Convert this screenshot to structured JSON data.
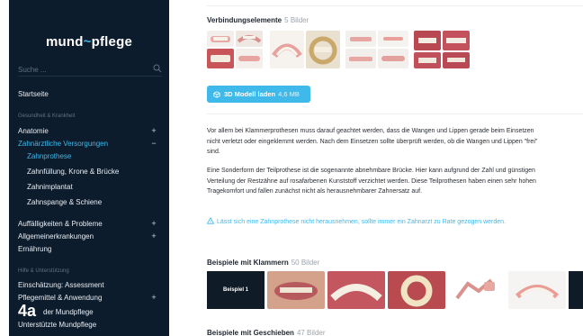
{
  "sidebar": {
    "logo_left": "mund",
    "logo_mid": "~",
    "logo_right": "pflege",
    "search_placeholder": "Suche ...",
    "home": "Startseite",
    "group1": "Gesundheit & Krankheit",
    "anatomie": "Anatomie",
    "zahn_versorgung": "Zahnärztliche Versorgungen",
    "sub1": "Zahnprothese",
    "sub2": "Zahnfüllung, Krone & Brücke",
    "sub3": "Zahnimplantat",
    "sub4": "Zahnspange & Schiene",
    "auffaellig": "Auffälligkeiten & Probleme",
    "allgemein": "Allgemeinerkrankungen",
    "ernaehrung": "Ernährung",
    "group2": "Hilfe & Unterstützung",
    "einschaetzung": "Einschätzung: Assessment",
    "pflegemittel": "Pflegemittel & Anwendung",
    "mundpflege_tail": "der Mundpflege",
    "unterstuetzt": "Unterstützte Mundpflege",
    "plus": "+",
    "minus": "−",
    "overlay_label": "4a"
  },
  "content": {
    "section1": {
      "title": "Verbindungselemente",
      "count": "5 Bilder"
    },
    "button": {
      "label": "3D Modell laden",
      "size": "4,6 MB"
    },
    "para1": "Vor allem bei Klammerprothesen muss darauf geachtet werden, dass die Wangen und Lippen gerade beim Einsetzen nicht verletzt oder eingeklemmt werden. Nach dem Einsetzen sollte überprüft werden, ob die Wangen und Lippen \"frei\" sind.",
    "para2": "Eine Sonderform der Teilprothese ist die sogenannte abnehmbare Brücke. Hier kann aufgrund der Zahl und günstigen Verteilung der Restzähne auf rosafarbenen Kunststoff verzichtet werden. Diese Teilprothesen haben einen sehr hohen Tragekomfort und fallen zunächst nicht als herausnehmbarer Zahnersatz auf.",
    "warning": "Lässt sich eine Zahnprothese nicht herausnehmen, sollte immer ein Zahnarzt zu Rate gezogen werden.",
    "section2": {
      "title": "Beispiele mit Klammern",
      "count": "50 Bilder",
      "first_tile": "Beispiel 1"
    },
    "section3": {
      "title": "Beispiele mit Geschieben",
      "count": "47 Bilder"
    }
  },
  "colors": {
    "sidebar_bg": "#0d1c2c",
    "accent": "#3fb8ea"
  }
}
